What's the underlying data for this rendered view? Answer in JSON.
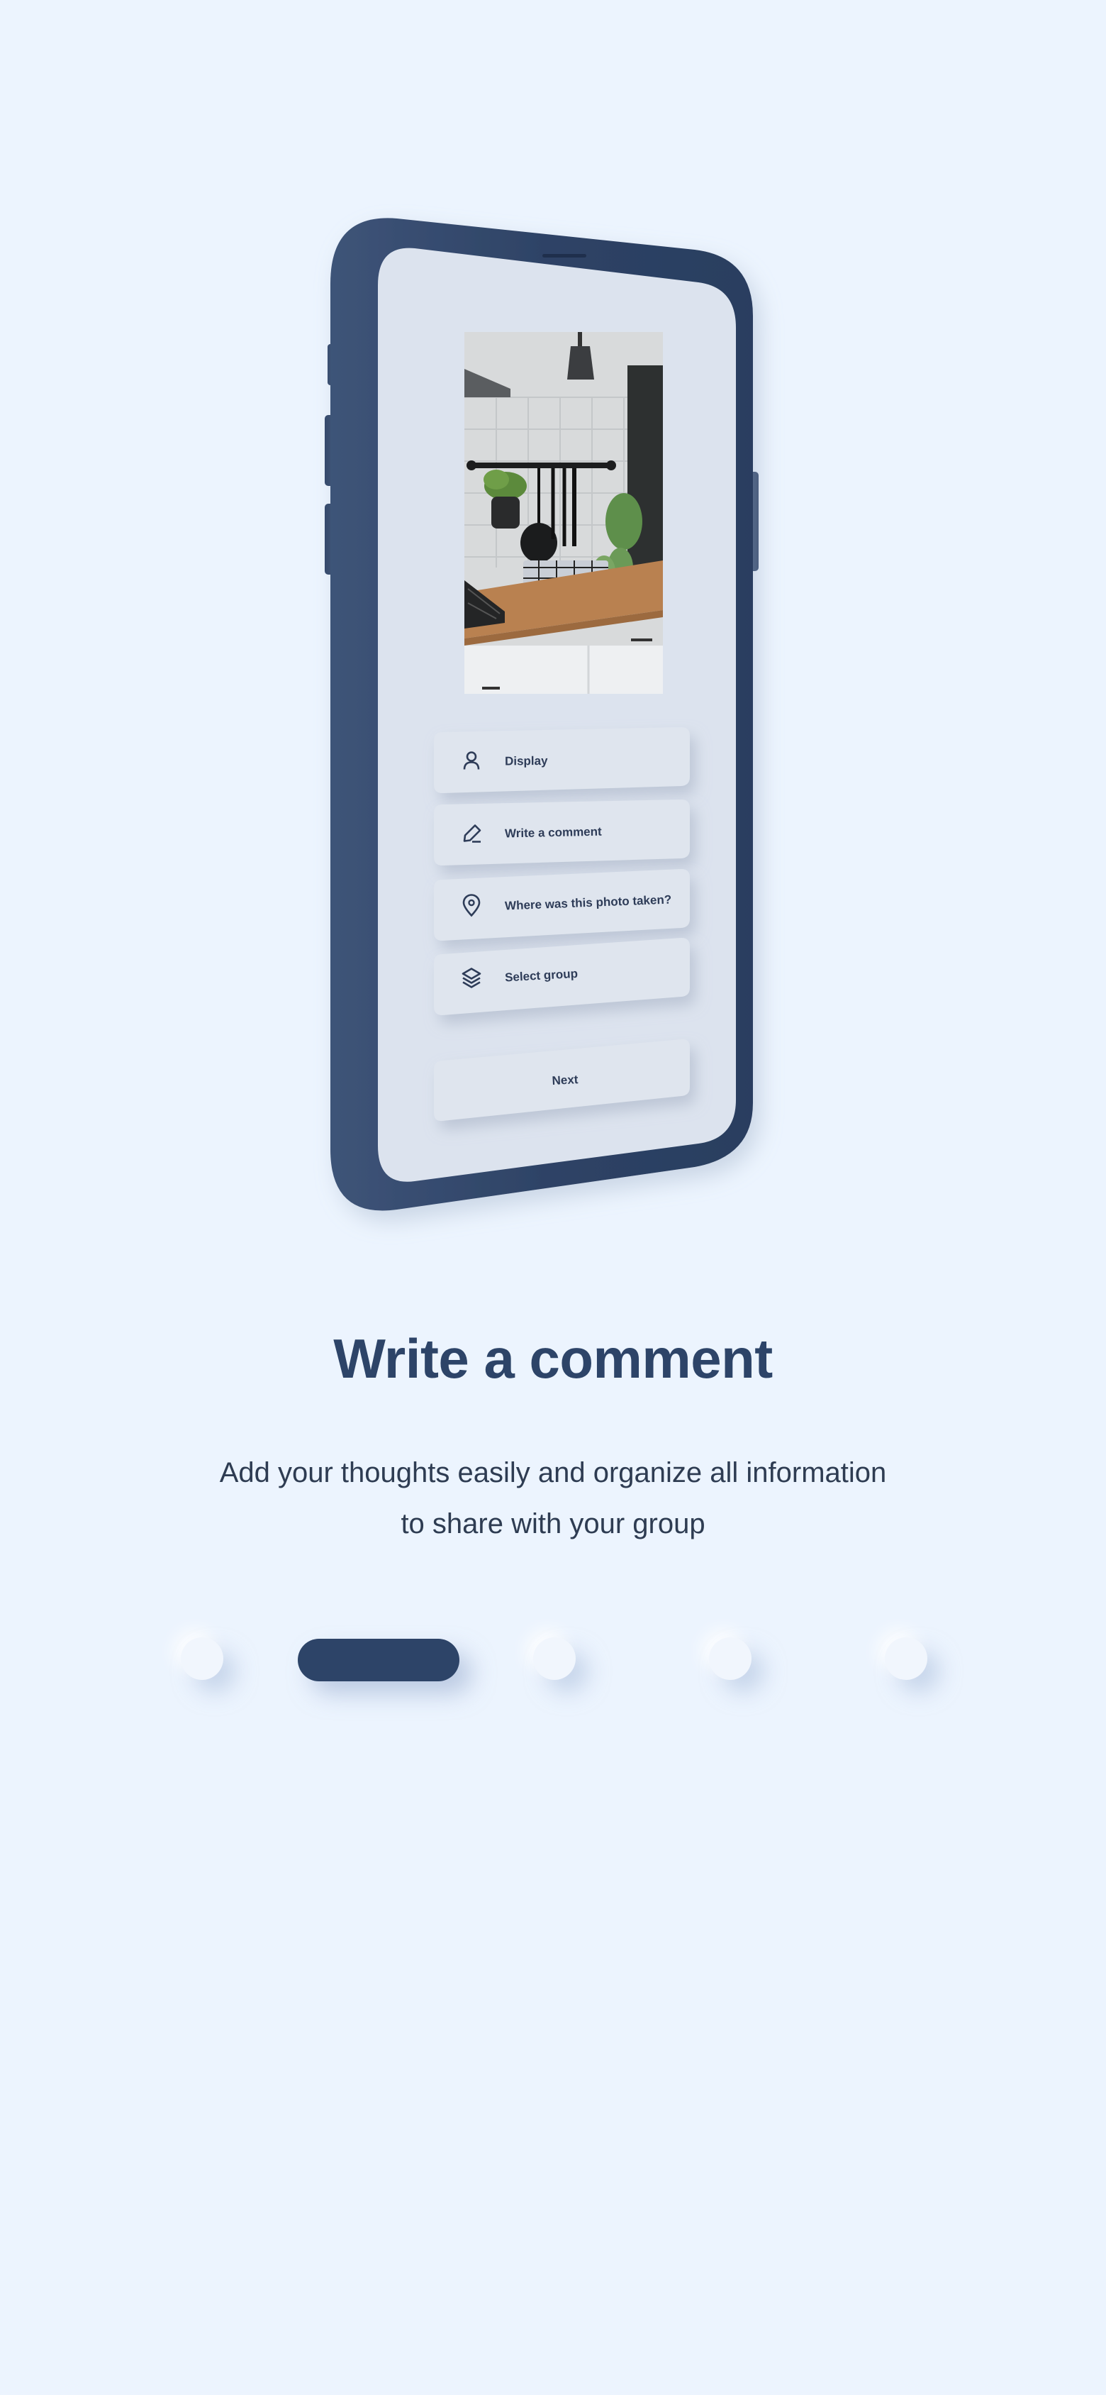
{
  "colors": {
    "page_bg": "#ecf4fe",
    "phone_frame": "#2f4467",
    "phone_screen": "#dce3ee",
    "accent": "#2d4468",
    "text": "#2e3c52"
  },
  "phone": {
    "photo_alt": "kitchen-photo",
    "menu": [
      {
        "icon": "user-icon",
        "label": "Display"
      },
      {
        "icon": "pencil-icon",
        "label": "Write a comment"
      },
      {
        "icon": "location-pin-icon",
        "label": "Where was this photo taken?"
      },
      {
        "icon": "layers-icon",
        "label": "Select group"
      }
    ],
    "next_label": "Next"
  },
  "onboarding": {
    "title": "Write a comment",
    "description_line1": "Add your thoughts easily and organize all information",
    "description_line2": "to share with your group"
  },
  "pagination": {
    "total": 5,
    "active_index": 1
  }
}
